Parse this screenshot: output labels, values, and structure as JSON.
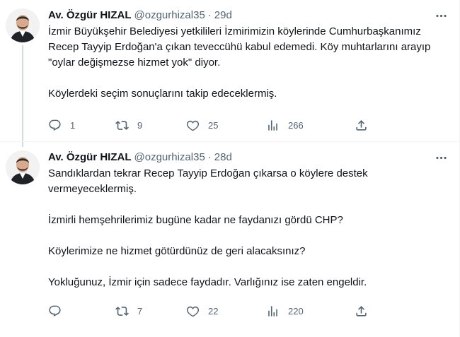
{
  "tweets": [
    {
      "author_name": "Av. Özgür HIZAL",
      "handle": "@ozgurhizal35",
      "separator": "·",
      "time": "29d",
      "paragraphs": [
        "İzmir Büyükşehir Belediyesi yetkilileri İzmirimizin köylerinde Cumhurbaşkanımız Recep Tayyip Erdoğan'a çıkan teveccühü kabul edemedi. Köy muhtarlarını arayıp \"oylar değişmezse hizmet yok\" diyor.",
        "Köylerdeki seçim sonuçlarını takip edeceklermiş."
      ],
      "replies": "1",
      "retweets": "9",
      "likes": "25",
      "views": "266"
    },
    {
      "author_name": "Av. Özgür HIZAL",
      "handle": "@ozgurhizal35",
      "separator": "·",
      "time": "28d",
      "paragraphs": [
        "Sandıklardan tekrar Recep Tayyip Erdoğan çıkarsa o köylere destek vermeyeceklermiş.",
        "İzmirli hemşehrilerimiz bugüne kadar ne faydanızı gördü CHP?",
        "Köylerimize ne hizmet götürdünüz de geri alacaksınız?",
        "Yokluğunuz, İzmir için sadece faydadır. Varlığınız ise zaten engeldir."
      ],
      "replies": "",
      "retweets": "7",
      "likes": "22",
      "views": "220"
    }
  ],
  "icons": {
    "more": "more-icon",
    "reply": "reply-icon",
    "retweet": "retweet-icon",
    "like": "heart-icon",
    "views": "views-icon",
    "share": "share-icon"
  },
  "colors": {
    "text": "#0f1419",
    "secondary": "#536471",
    "border": "#eff3f4",
    "thread_line": "#cfd9de"
  }
}
